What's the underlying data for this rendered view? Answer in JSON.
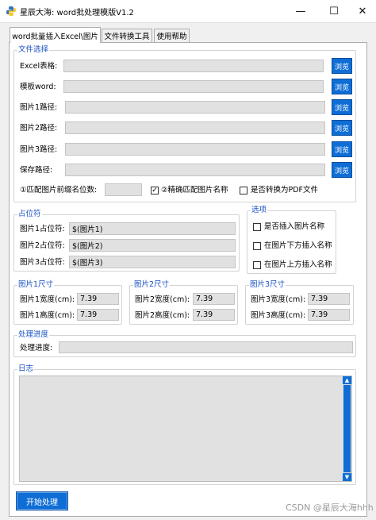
{
  "window": {
    "title": "星辰大海: word批处理模版V1.2",
    "controls": {
      "minimize": "—",
      "maximize": "☐",
      "close": "✕"
    }
  },
  "tabs": [
    {
      "label": "word批量插入Excel\\图片"
    },
    {
      "label": "文件转换工具"
    },
    {
      "label": "使用帮助"
    }
  ],
  "file_select": {
    "legend": "文件选择",
    "browse_label": "浏览",
    "rows": [
      {
        "label": "Excel表格:",
        "value": ""
      },
      {
        "label": "模板word:",
        "value": ""
      },
      {
        "label": "图片1路径:",
        "value": ""
      },
      {
        "label": "图片2路径:",
        "value": ""
      },
      {
        "label": "图片3路径:",
        "value": ""
      },
      {
        "label": "保存路径:",
        "value": ""
      }
    ],
    "prefix_label": "①匹配图片前缀名位数:",
    "prefix_value": "",
    "exact_match_label": "②精确匹配图片名称",
    "exact_match_checked": true,
    "exact_match_mark": "✓",
    "convert_pdf_label": "是否转换为PDF文件",
    "convert_pdf_checked": false
  },
  "placeholders": {
    "legend": "占位符",
    "rows": [
      {
        "label": "图片1占位符:",
        "value": "$(图片1)"
      },
      {
        "label": "图片2占位符:",
        "value": "$(图片2)"
      },
      {
        "label": "图片3占位符:",
        "value": "$(图片3)"
      }
    ]
  },
  "options": {
    "legend": "选项",
    "items": [
      {
        "label": "是否插入图片名称",
        "checked": false
      },
      {
        "label": "在图片下方插入名称",
        "checked": false
      },
      {
        "label": "在图片上方插入名称",
        "checked": false
      }
    ]
  },
  "sizes": [
    {
      "legend": "图片1尺寸",
      "width_label": "图片1宽度(cm):",
      "width": "7.39",
      "height_label": "图片1高度(cm):",
      "height": "7.39"
    },
    {
      "legend": "图片2尺寸",
      "width_label": "图片2宽度(cm):",
      "width": "7.39",
      "height_label": "图片2高度(cm):",
      "height": "7.39"
    },
    {
      "legend": "图片3尺寸",
      "width_label": "图片3宽度(cm):",
      "width": "7.39",
      "height_label": "图片3高度(cm):",
      "height": "7.39"
    }
  ],
  "progress": {
    "legend": "处理进度",
    "label": "处理进度:",
    "value": 0
  },
  "log": {
    "legend": "日志",
    "content": "",
    "scroll_up": "▲",
    "scroll_down": "▼"
  },
  "start_button": "开始处理",
  "watermark": "CSDN @星辰大海hhh",
  "colors": {
    "accent": "#0f6ed6",
    "legend_text": "#1a52c4",
    "field_bg": "#e1e1e1"
  }
}
